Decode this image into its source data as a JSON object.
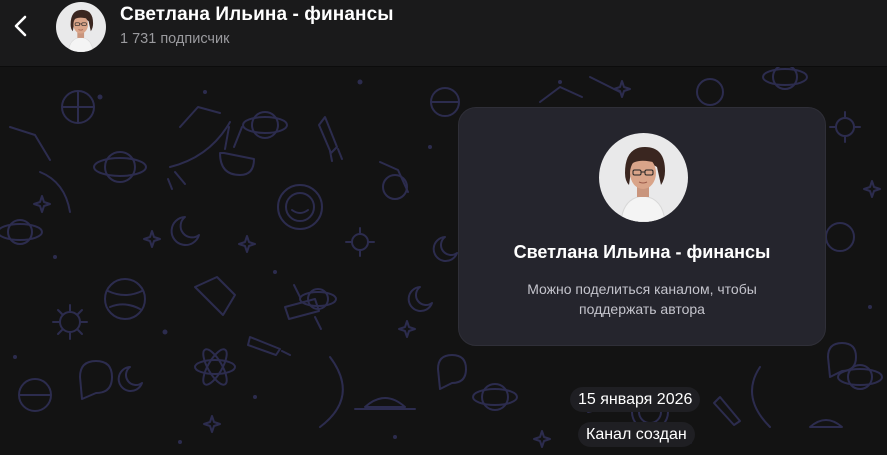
{
  "header": {
    "title": "Светлана Ильина - финансы",
    "subtitle": "1 731 подписчик"
  },
  "card": {
    "title": "Светлана Ильина - финансы",
    "description": "Можно поделиться каналом, чтобы поддержать автора"
  },
  "service": {
    "date": "15 января 2026",
    "created": "Канал создан"
  },
  "icons": {
    "back": "chevron-left-icon",
    "avatar": "avatar-photo"
  },
  "colors": {
    "header_bg": "#1a1a1b",
    "chat_bg": "#131313",
    "card_bg": "#25252d",
    "pattern": "#2a2a4a"
  }
}
